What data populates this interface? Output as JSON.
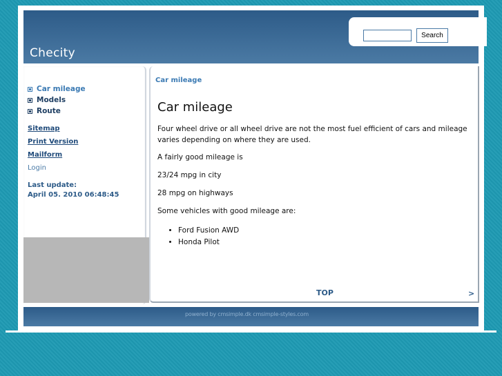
{
  "site": {
    "title": "Checity"
  },
  "search": {
    "placeholder": "",
    "button_label": "Search"
  },
  "sidebar": {
    "menu": [
      {
        "label": "Car mileage",
        "active": true
      },
      {
        "label": "Models",
        "active": false
      },
      {
        "label": "Route",
        "active": false
      }
    ],
    "links": {
      "sitemap": "Sitemap",
      "print_version": "Print Version",
      "mailform": "Mailform"
    },
    "login": "Login",
    "last_update_label": "Last update:",
    "last_update_value": "April 05. 2010 06:48:45"
  },
  "content": {
    "breadcrumb": "Car mileage",
    "heading": "Car mileage",
    "paragraphs": [
      " Four wheel drive or all wheel drive are not the most fuel efficient of cars and mileage varies depending on where they are used.",
      "A fairly good mileage is",
      "23/24 mpg in city",
      "28 mpg  on highways",
      "Some vehicles with good mileage are:"
    ],
    "list": [
      "Ford Fusion AWD",
      "Honda Pilot"
    ],
    "top_link": "TOP",
    "next_link": ">"
  },
  "footer": {
    "text": "powered by cmsimple.dk    cmsimple-styles.com"
  },
  "colors": {
    "background": "#1e9ab3",
    "header": "#3a6a96",
    "link": "#2d5b88",
    "active_menu": "#3b7ab3"
  }
}
